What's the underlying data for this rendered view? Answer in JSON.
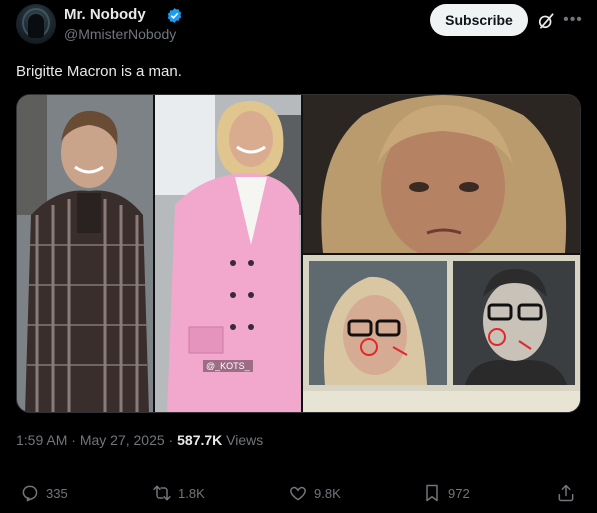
{
  "author": {
    "name": "Mr. Nobody",
    "handle": "@MmisterNobody",
    "verified_color": "#1d9bf0"
  },
  "header": {
    "subscribe_label": "Subscribe"
  },
  "tweet": {
    "text": "Brigitte Macron is a man.",
    "media_watermark": "@_KOTS_"
  },
  "meta": {
    "time": "1:59 AM",
    "separator": " · ",
    "date": "May 27, 2025",
    "views_count": "587.7K",
    "views_label": " Views"
  },
  "actions": {
    "replies": "335",
    "reposts": "1.8K",
    "likes": "9.8K",
    "bookmarks": "972"
  },
  "icons": [
    "verified-badge-icon",
    "grok-icon",
    "more-icon",
    "reply-icon",
    "retweet-icon",
    "like-icon",
    "bookmark-icon",
    "share-icon"
  ],
  "colors": {
    "background": "#000000",
    "text": "#e7e9ea",
    "secondary": "#71767b",
    "accent": "#1d9bf0"
  }
}
